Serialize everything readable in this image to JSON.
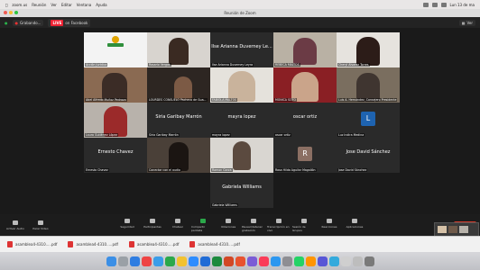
{
  "menubar": {
    "items": [
      "zoom.us",
      "Reunión",
      "Ver",
      "Editar",
      "Ventana",
      "Ayuda"
    ],
    "clock": "Lun 13 de ma"
  },
  "window": {
    "title": "Reunión de Zoom"
  },
  "infobar": {
    "speaker": "Grabando...",
    "live": "LIVE",
    "platform": "on Facebook",
    "view_label": "Ver"
  },
  "tiles": [
    {
      "name": "Acción Jurídica",
      "type": "logo"
    },
    {
      "name": "Rosario Vergas",
      "type": "video"
    },
    {
      "name": "Ilse Arianna Duverney Leyra",
      "type": "text",
      "big": "Ilse Arianna Duverney Le..."
    },
    {
      "name": "REBECA MALTOS",
      "type": "video"
    },
    {
      "name": "Cheryl Alvarez Torres",
      "type": "video"
    },
    {
      "name": "Abel Alfredo Muñoz Pedraza",
      "type": "video"
    },
    {
      "name": "LOURDES CONSUELO Pacheco de Gua...",
      "type": "video"
    },
    {
      "name": "FABIOLA MALTOS",
      "type": "video"
    },
    {
      "name": "MÓNICA SOTO",
      "type": "video"
    },
    {
      "name": "Luis A. Hernández, Consejero Presidente",
      "type": "video"
    },
    {
      "name": "Laura Gutiérrez López",
      "type": "video"
    },
    {
      "name": "Siria Garibay Marrón",
      "type": "text",
      "big": "Siria Garibay Marrón"
    },
    {
      "name": "mayra lopez",
      "type": "text",
      "big": "mayra lopez"
    },
    {
      "name": "oscar ortiz",
      "type": "text",
      "big": "oscar ortiz"
    },
    {
      "name": "Luz Indira Medina",
      "type": "initial",
      "initial": "L"
    },
    {
      "name": "Ernesto Chavez",
      "type": "text",
      "big": "Ernesto Chavez"
    },
    {
      "name": "Conectar con el audio",
      "type": "video"
    },
    {
      "name": "Ramon Garza",
      "type": "video"
    },
    {
      "name": "Rosa Hilda Aguilar Magallón",
      "type": "initial",
      "initial": "R"
    },
    {
      "name": "Jose David Sánchez",
      "type": "text",
      "big": "Jose David Sánchez"
    },
    {
      "name": "Gabriela Williams",
      "type": "text",
      "big": "Gabriela Williams"
    }
  ],
  "toolbar": {
    "left": [
      "Activar Audio",
      "Parar Video"
    ],
    "mid": [
      "Seguridad",
      "Participantes",
      "Chatear",
      "Compartir pantalla",
      "Votaciones",
      "Pausar/detener grabación",
      "Transcripción en vivo",
      "Sesión de Grupos",
      "Reacciones",
      "Aplicaciones"
    ],
    "end": "Finalizar"
  },
  "downloads": [
    "asamblea4-4310.....pdf",
    "asamblea4-4310.....pdf",
    "asamblea4-4310.....pdf",
    "asamblea4-4310.....pdf"
  ],
  "colors": {
    "initial_l": "#1e63b0",
    "initial_r": "#8b6f63",
    "end_red": "#d53a2c",
    "share_green": "#2ba84a"
  }
}
